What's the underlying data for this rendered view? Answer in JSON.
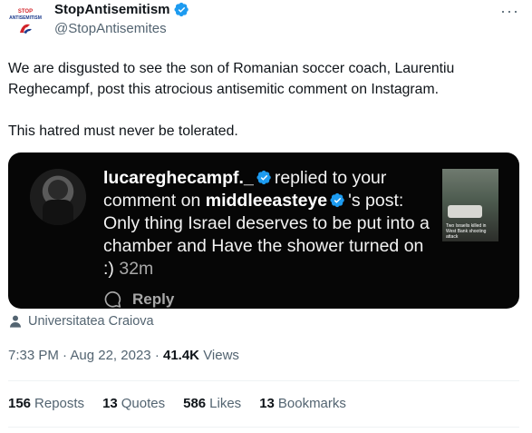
{
  "author": {
    "display_name": "StopAntisemitism",
    "handle": "@StopAntisemites",
    "avatar_text": "STOP ANTISEMITISM"
  },
  "more_label": "···",
  "tweet": {
    "paragraph_1": "We are disgusted to see the son of Romanian soccer coach, Laurentiu Reghecampf, post this atrocious antisemitic comment on Instagram.",
    "paragraph_2": "This hatred must never be tolerated."
  },
  "media": {
    "commenter": "lucareghecampf._",
    "replied_text": "replied to your comment on",
    "account": "middleeasteye",
    "post_suffix": "'s post:",
    "comment": "Only thing Israel deserves to be put into a chamber and Have the shower turned on :)",
    "time": "32m",
    "reply_label": "Reply",
    "thumbnail_caption": "Two Israelis killed in West Bank shooting attack"
  },
  "location": "Universitatea Craiova",
  "meta": {
    "time": "7:33 PM",
    "date": "Aug 22, 2023",
    "separator": "·",
    "views_count": "41.4K",
    "views_label": "Views"
  },
  "stats": [
    {
      "count": "156",
      "label": "Reposts"
    },
    {
      "count": "13",
      "label": "Quotes"
    },
    {
      "count": "586",
      "label": "Likes"
    },
    {
      "count": "13",
      "label": "Bookmarks"
    }
  ],
  "colors": {
    "verified_blue": "#1d9bf0",
    "text_primary": "#0f1419",
    "text_secondary": "#536471",
    "media_bg": "#060606",
    "logo_red": "#d2232a",
    "logo_blue": "#1b3a8c"
  },
  "icons": {
    "verified": "verified-badge-icon",
    "location": "person-location-icon",
    "comment": "speech-bubble-icon"
  }
}
